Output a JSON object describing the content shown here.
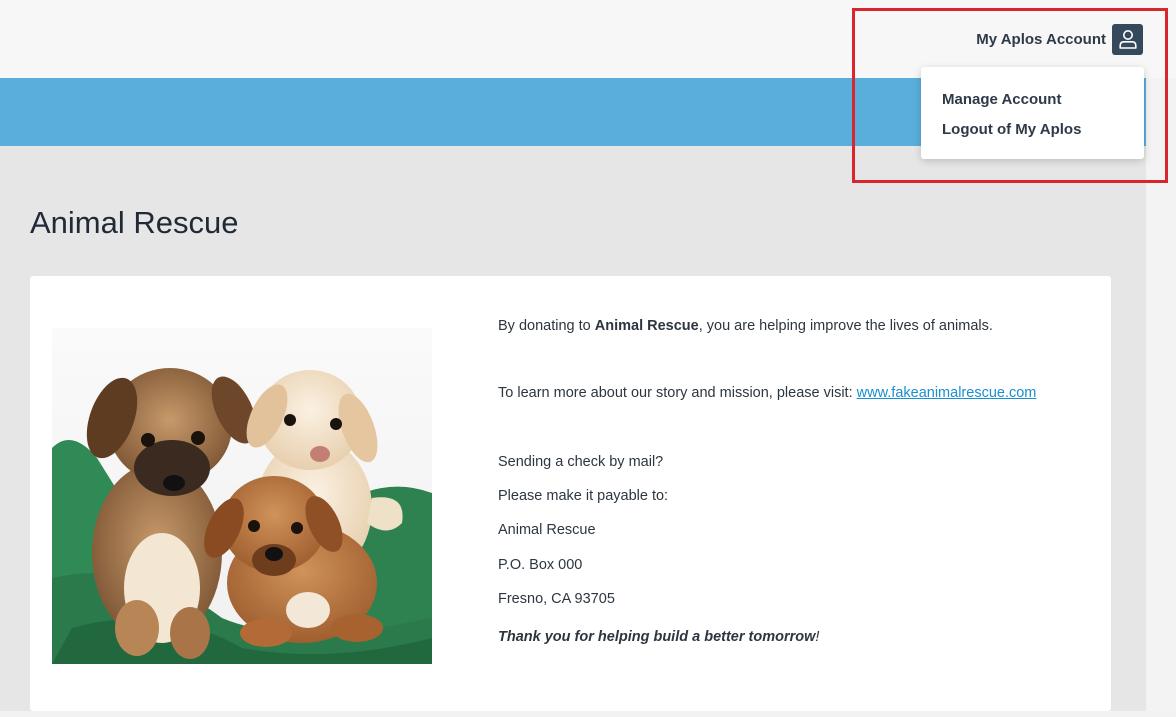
{
  "header": {
    "account_label": "My Aplos Account",
    "account_icon": "user-icon"
  },
  "account_menu": {
    "items": [
      {
        "label": "Manage Account"
      },
      {
        "label": "Logout of My Aplos"
      }
    ]
  },
  "page": {
    "title": "Animal Rescue"
  },
  "card": {
    "image_alt": "puppies-photo",
    "intro_prefix": "By donating to ",
    "intro_org": "Animal Rescue",
    "intro_suffix": ", you are helping improve the lives of animals.",
    "learn_more_prefix": "To learn more about our story and mission, please visit: ",
    "learn_more_link": "www.fakeanimalrescue.com",
    "check_question": "Sending a check by mail?",
    "payable_to": "Please make it payable to:",
    "address_name": "Animal Rescue",
    "address_box": "P.O. Box 000",
    "address_city": "Fresno, CA 93705",
    "thanks_main": "Thank you for helping build a better tomorrow",
    "thanks_mark": "!"
  },
  "colors": {
    "brand_blue": "#5aaedb",
    "link": "#1a8fd0",
    "highlight_red": "#d7262e",
    "avatar_bg": "#34495c"
  }
}
